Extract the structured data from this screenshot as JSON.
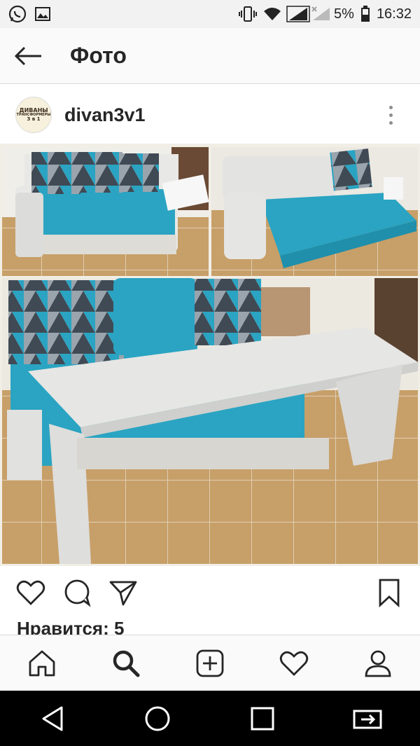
{
  "status_bar": {
    "battery_percent": "5%",
    "time": "16:32",
    "icons": [
      "whatsapp-icon",
      "gallery-icon",
      "vibrate-icon",
      "wifi-icon",
      "signal-icon",
      "signal-no-service-icon",
      "battery-icon"
    ]
  },
  "header": {
    "title": "Фото",
    "back_icon": "arrow-left-icon"
  },
  "post": {
    "username": "divan3v1",
    "avatar_text": [
      "ДИВАНЫ",
      "ТРАНСФОРМЕРЫ",
      "3 в 1"
    ],
    "likes_text": "Нравится: 5"
  },
  "actions": [
    "heart-icon",
    "comment-icon",
    "share-icon",
    "bookmark-icon"
  ],
  "bottom_nav": [
    "home-icon",
    "search-icon",
    "add-icon",
    "activity-icon",
    "profile-icon"
  ],
  "android_nav": [
    "back-triangle-icon",
    "home-circle-icon",
    "recents-square-icon",
    "screen-share-icon"
  ],
  "colors": {
    "sofa_blue": "#2aa4c2",
    "sofa_white": "#e8e8e6",
    "floor": "#c9a46f",
    "text": "#262626"
  }
}
